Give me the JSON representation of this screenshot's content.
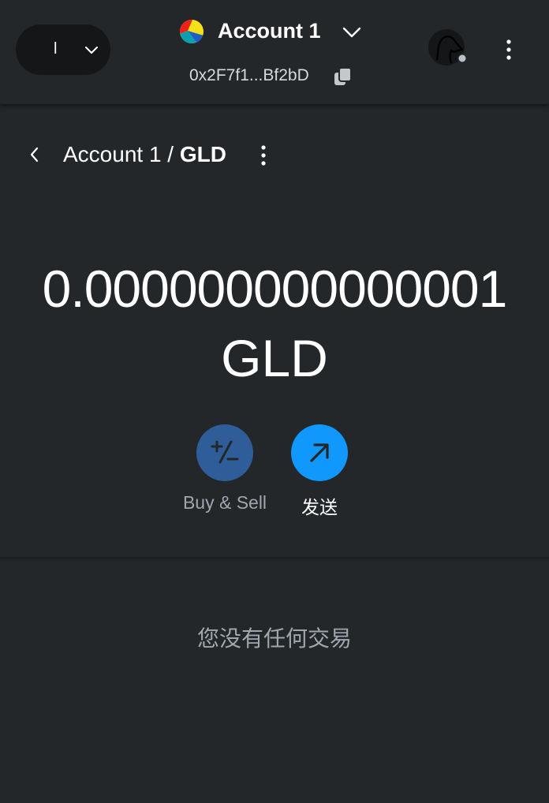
{
  "header": {
    "network_initial": "l",
    "account_name": "Account 1",
    "address": "0x2F7f1...Bf2bD"
  },
  "asset": {
    "breadcrumb_account": "Account 1 / ",
    "breadcrumb_token": "GLD",
    "balance_value": "0.000000000000001",
    "balance_unit": "GLD"
  },
  "actions": {
    "buy_sell_label": "Buy & Sell",
    "send_label": "发送"
  },
  "transactions": {
    "empty_message": "您没有任何交易"
  },
  "icons": {
    "network_chevron": "chevron-down-icon",
    "account_avatar": "jazzicon",
    "account_chevron": "chevron-down-icon",
    "copy": "copy-icon",
    "profile": "profile-avatar",
    "menu": "kebab-menu-icon",
    "back": "chevron-left-icon",
    "buy_sell": "plus-minus-icon",
    "send": "arrow-up-right-icon"
  },
  "colors": {
    "background": "#24272a",
    "primary": "#1098fc",
    "buy_sell_bg": "#2e5d9a",
    "muted_text": "#9fa6ae"
  }
}
